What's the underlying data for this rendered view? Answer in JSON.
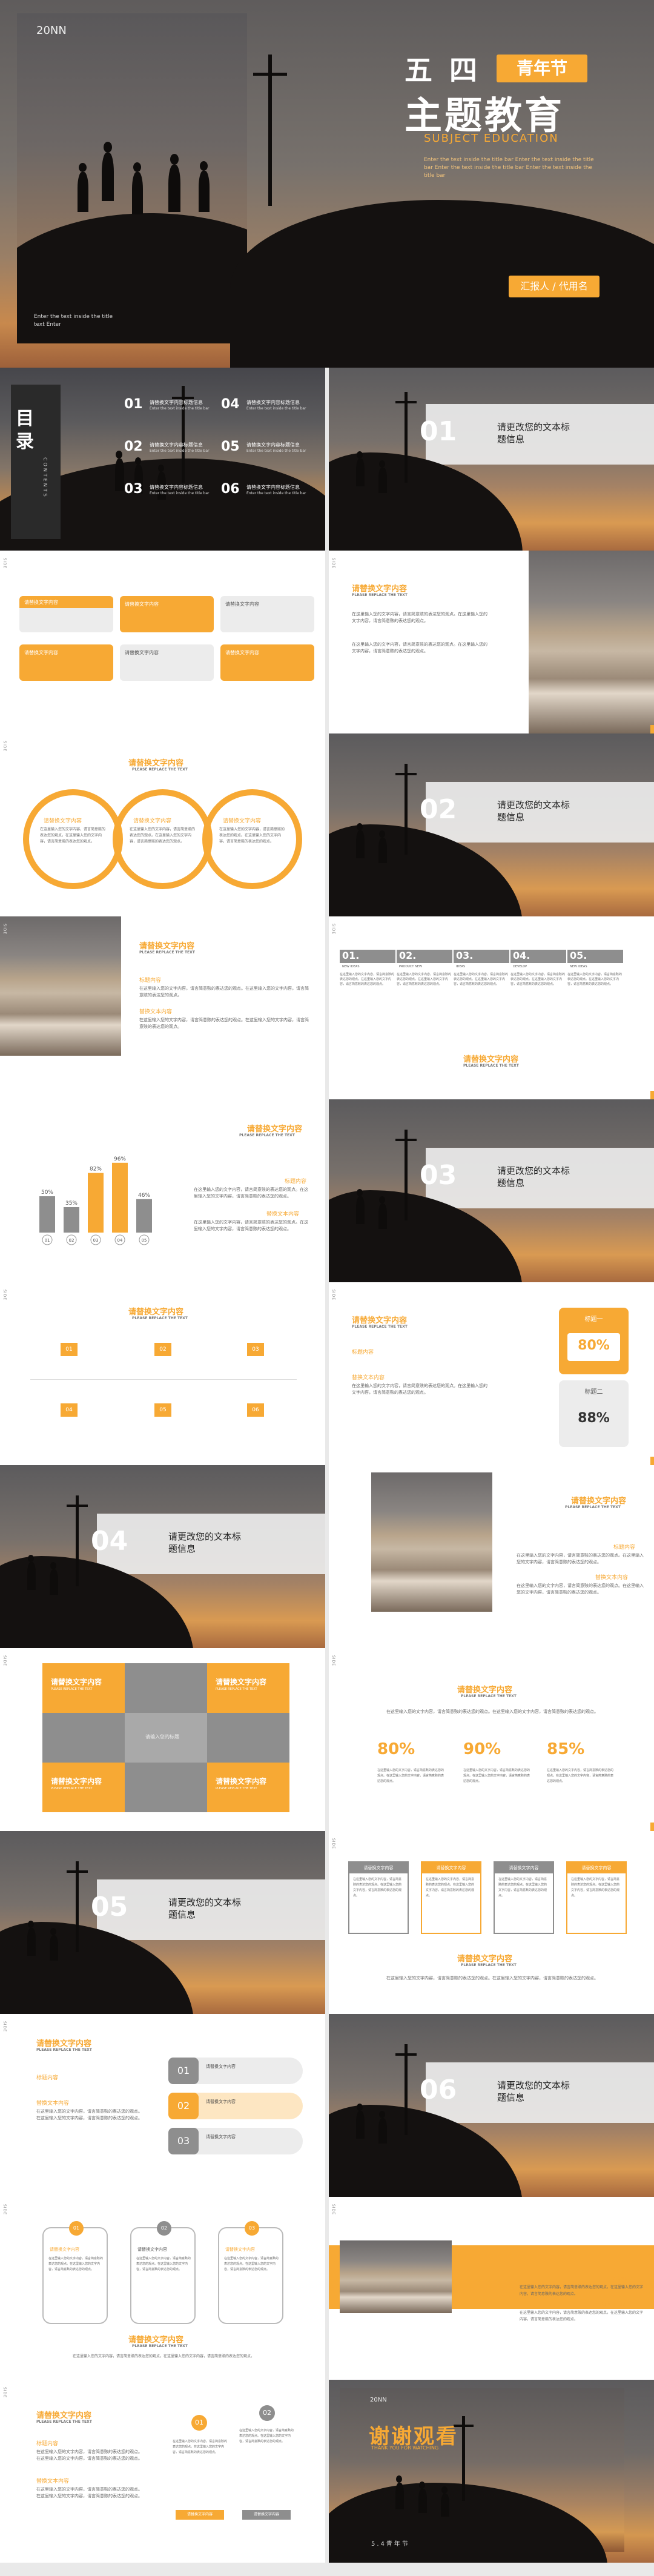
{
  "cover": {
    "year": "20NN",
    "title_top": "五 四",
    "badge": "青年节",
    "title_main": "主题教育",
    "subtitle_en": "SUBJECT EDUCATION",
    "desc": "Enter the text inside the title bar Enter the text inside the title bar Enter the text inside the title bar Enter the text inside the title bar",
    "photo_caption": "Enter the text inside the title text Enter",
    "reporter": "汇报人 / 代用名"
  },
  "toc": {
    "title": "目 录",
    "en": "CONTENTS",
    "items": [
      {
        "num": "01",
        "title": "请替换文字内容标题信息"
      },
      {
        "num": "02",
        "title": "请替换文字内容标题信息"
      },
      {
        "num": "03",
        "title": "请替换文字内容标题信息"
      },
      {
        "num": "04",
        "title": "请替换文字内容标题信息"
      },
      {
        "num": "05",
        "title": "请替换文字内容标题信息"
      },
      {
        "num": "06",
        "title": "请替换文字内容标题信息"
      }
    ],
    "item_desc": "Enter the text inside the title bar"
  },
  "sections": [
    {
      "num": "01",
      "text": "请更改您的文本标题信息"
    },
    {
      "num": "02",
      "text": "请更改您的文本标题信息"
    },
    {
      "num": "03",
      "text": "请更改您的文本标题信息"
    },
    {
      "num": "04",
      "text": "请更改您的文本标题信息"
    },
    {
      "num": "05",
      "text": "请更改您的文本标题信息"
    },
    {
      "num": "06",
      "text": "请更改您的文本标题信息"
    }
  ],
  "common": {
    "title": "请替换文字内容",
    "sub": "PLEASE REPLACE THE TEXT",
    "label_a": "标题内容",
    "label_b": "替换文本内容",
    "body": "在这里输入您的文字内容，请言简意赅的表达您的观点。在这里输入您的文字内容，请言简意赅的表达您的观点。",
    "side": "SIDE"
  },
  "cards": {
    "a": "请替换文字内容",
    "b": "请替换文字内容"
  },
  "five": {
    "nums": [
      "01.",
      "02.",
      "03.",
      "04.",
      "05."
    ],
    "labels": [
      "NEW IDEAS",
      "PRODUCT NEW",
      "IDEAS",
      "DEVELOP",
      "NEW IDEAS"
    ]
  },
  "chart_data": {
    "type": "bar",
    "categories": [
      "01",
      "02",
      "03",
      "04",
      "05"
    ],
    "values": [
      50,
      35,
      82,
      96,
      46
    ],
    "labels": [
      "50%",
      "35%",
      "82%",
      "96%",
      "46%"
    ],
    "colors": [
      "#8e8e8e",
      "#8e8e8e",
      "#f7a934",
      "#f7a934",
      "#8e8e8e"
    ]
  },
  "progress": {
    "a_label": "标题一",
    "a_val": "80%",
    "b_label": "标题二",
    "b_val": "88%"
  },
  "pct": [
    "80%",
    "90%",
    "85%"
  ],
  "grid": {
    "cell_title": "请替换文字内容",
    "cell_sub": "PLEASE REPLACE THE TEXT",
    "mid": "请输入您的标题"
  },
  "nums3": [
    "01",
    "02",
    "03"
  ],
  "thanks": {
    "year": "20NN",
    "title": "谢谢观看",
    "en": "THANK YOU FOR WATCHING",
    "foot": "5.4青年节"
  },
  "buttons": {
    "a": "请替换文字内容",
    "b": "请替换文字内容"
  },
  "colors": {
    "accent": "#f7a934",
    "gray": "#8e8e8e"
  }
}
